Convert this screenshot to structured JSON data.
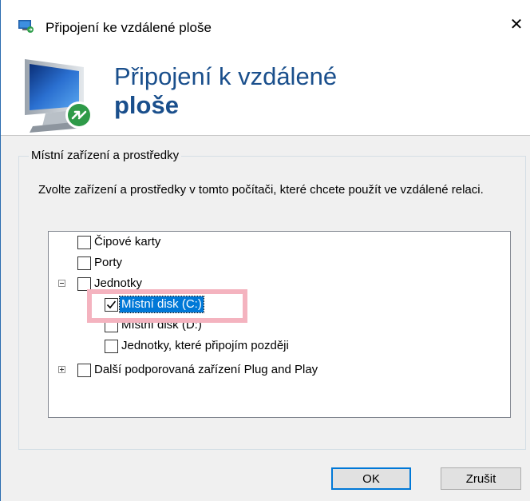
{
  "window": {
    "title": "Připojení ke vzdálené ploše",
    "close_glyph": "✕"
  },
  "banner": {
    "title_line1": "Připojení k vzdálené",
    "title_line2": "ploše",
    "icon": "remote-desktop-monitor-icon"
  },
  "group": {
    "legend": "Místní zařízení a prostředky",
    "description": "Zvolte zařízení a prostředky v tomto počítači, které chcete použít ve vzdálené relaci."
  },
  "tree": {
    "items": [
      {
        "label": "Čipové karty",
        "checked": false
      },
      {
        "label": "Porty",
        "checked": false
      },
      {
        "label": "Jednotky",
        "checked": false,
        "expanded": true
      },
      {
        "label": "Místní disk (C:)",
        "checked": true,
        "selected": true
      },
      {
        "label": "Místní disk (D:)",
        "checked": false
      },
      {
        "label": "Jednotky, které připojím později",
        "checked": false
      },
      {
        "label": "Další podporovaná zařízení Plug and Play",
        "checked": false,
        "expanded": false
      }
    ]
  },
  "buttons": {
    "ok": "OK",
    "cancel": "Zrušit"
  },
  "colors": {
    "accent": "#0078d7",
    "banner_text": "#1a4f8c",
    "highlight": "#f4b3bf"
  }
}
